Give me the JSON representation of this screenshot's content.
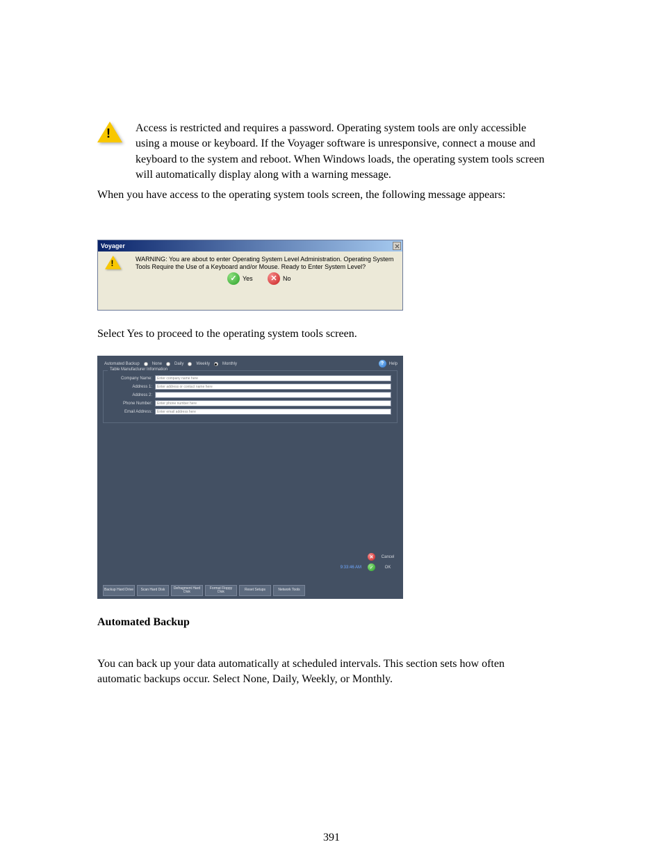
{
  "instruction_1": "Access is restricted and requires a password. Operating system tools are only accessible using a mouse or keyboard. If the Voyager software is unresponsive, connect a mouse and keyboard to the system and reboot. When Windows loads, the operating system tools screen will automatically display along with a warning message.",
  "instruction_2": "When you have access to the operating system tools screen, the following message appears:",
  "dialog": {
    "title": "Voyager",
    "warning_text": "WARNING: You are about to enter Operating System Level Administration. Operating System Tools Require the Use of a Keyboard and/or Mouse.  Ready to Enter System Level?",
    "yes_label": "Yes",
    "no_label": "No"
  },
  "instruction_3": "Select Yes to proceed to the operating system tools screen.",
  "admin": {
    "backup_label": "Automated Backup",
    "backup_options": {
      "none": "None",
      "daily": "Daily",
      "weekly": "Weekly",
      "monthly": "Monthly"
    },
    "help_label": "Help",
    "fieldset_title": "Table Manufacturer Information",
    "labels": {
      "company": "Company Name:",
      "addr1": "Address 1:",
      "addr2": "Address 2:",
      "phone": "Phone Number:",
      "email": "Email Address:"
    },
    "placeholders": {
      "company": "Enter company name here",
      "addr1": "Enter address or contact name here",
      "addr2": "",
      "phone": "Enter phone number here",
      "email": "Enter email address here"
    },
    "cancel_label": "Cancel",
    "ok_label": "OK",
    "clock": "9:33:46 AM",
    "tabs": {
      "backup": "Backup Hard Drive",
      "scan": "Scan Hard Disk",
      "defrag": "Defragment Hard Disk",
      "format": "Format Floppy Disk",
      "reset": "Reset Setups",
      "network": "Network Tools"
    }
  },
  "automated_backup_heading": "Automated Backup",
  "automated_backup_text": "You can back up your data automatically at scheduled intervals. This section sets how often automatic backups occur. Select None, Daily, Weekly, or Monthly.",
  "page_number": "391"
}
